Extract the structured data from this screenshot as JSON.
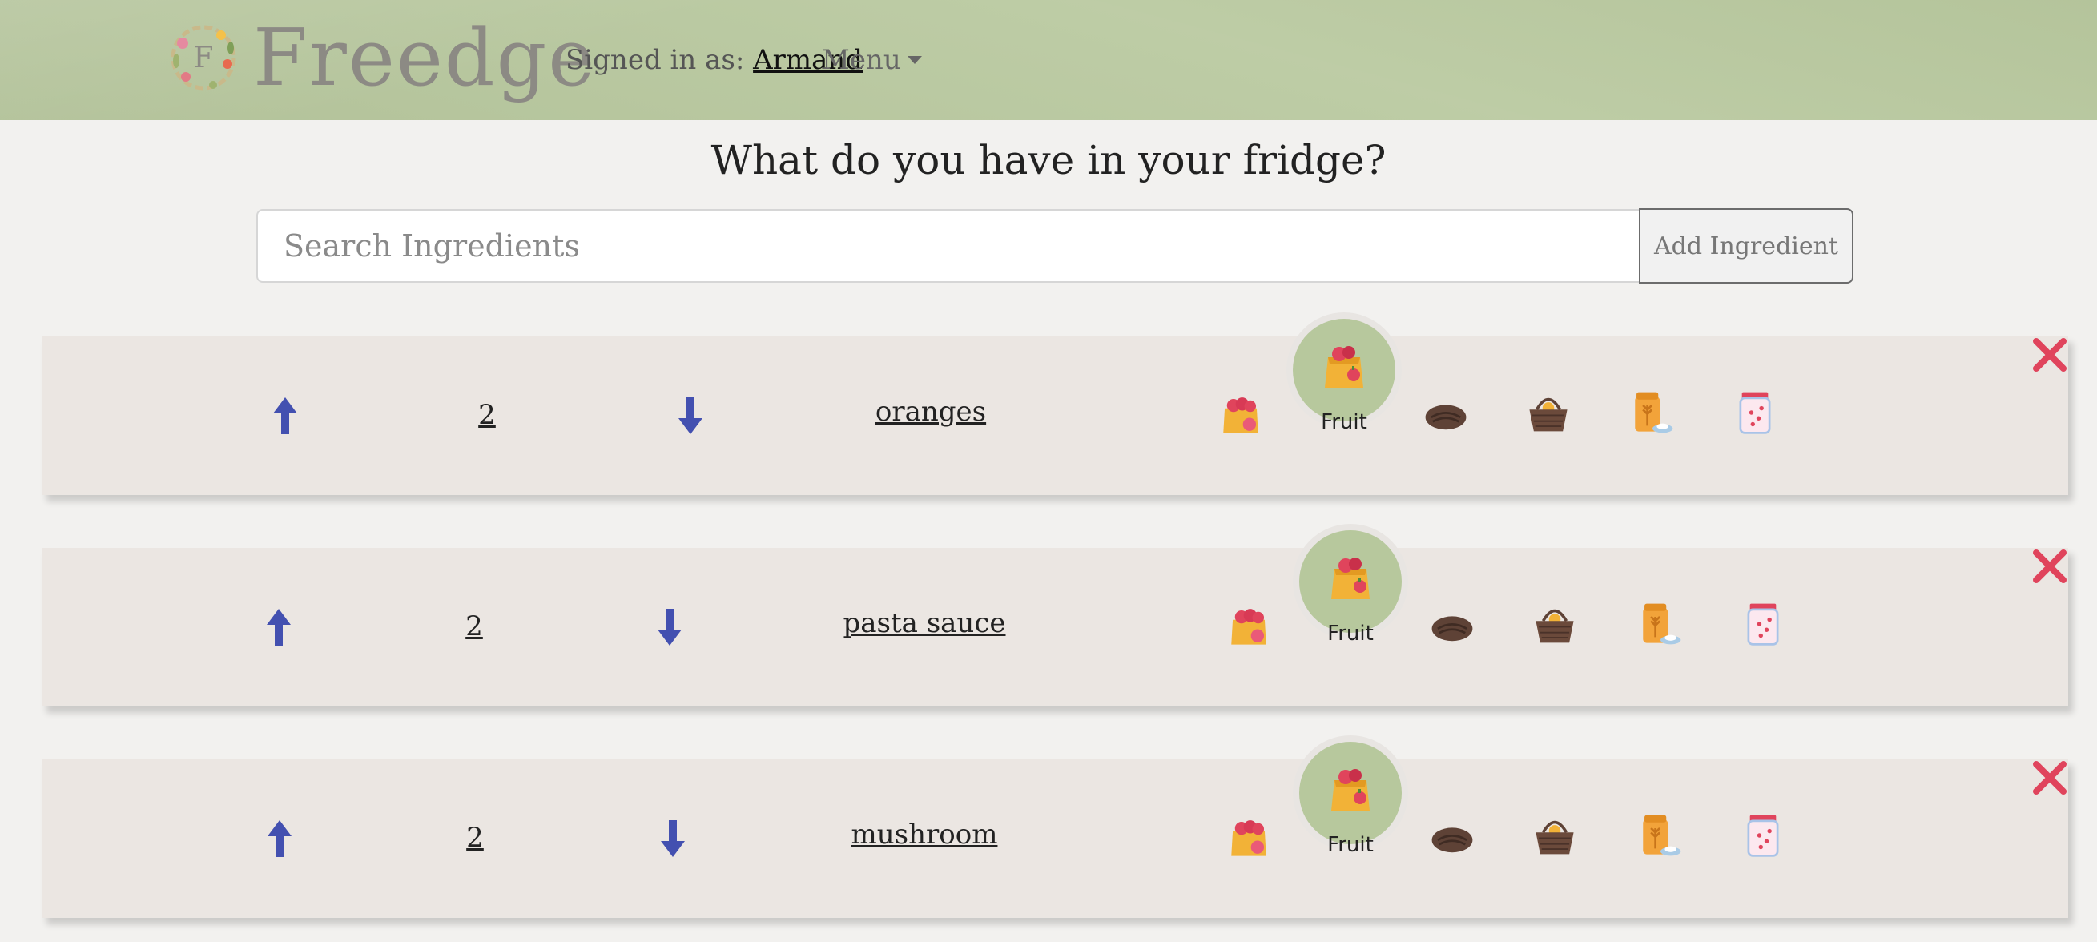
{
  "header": {
    "brand": "Freedge",
    "logo_letter": "F",
    "signed_in_prefix": "Signed in as:",
    "username": "Armand",
    "menu_label": "Menu"
  },
  "main": {
    "title": "What do you have in your fridge?",
    "search_placeholder": "Search Ingredients",
    "add_button_label": "Add Ingredient"
  },
  "ingredients": [
    {
      "name": "oranges",
      "quantity": "2",
      "category": "Fruit"
    },
    {
      "name": "pasta sauce",
      "quantity": "2",
      "category": "Fruit"
    },
    {
      "name": "mushroom",
      "quantity": "2",
      "category": "Fruit"
    }
  ],
  "category_icons": [
    "fruit-bag-icon",
    "vegetable-bag-icon",
    "meat-icon",
    "bread-basket-icon",
    "grain-icon",
    "jam-jar-icon"
  ],
  "colors": {
    "header_bg": "#b8c89e",
    "arrow": "#4350b0",
    "delete": "#e0445c",
    "selected_category": "#b7c89d",
    "row_bg": "#ebe6e2"
  }
}
